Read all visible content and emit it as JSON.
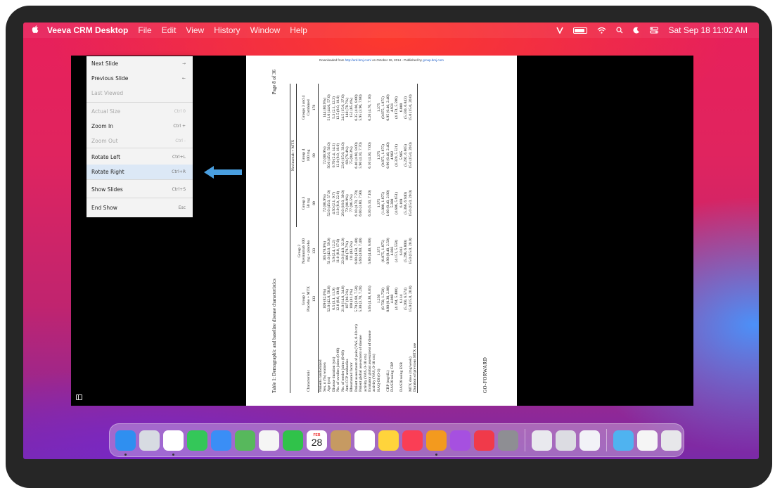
{
  "menubar": {
    "app_name": "Veeva CRM Desktop",
    "menus": [
      "File",
      "Edit",
      "View",
      "History",
      "Window",
      "Help"
    ],
    "clock": "Sat Sep 18  11:02 AM"
  },
  "slide": {
    "download_prefix": "Downloaded from ",
    "download_link": "http://ard.bmj.com/",
    "download_mid": " on October 26, 2014 - Published by ",
    "download_link2": "group.bmj.com",
    "table_title": "Table 1: Demographic and baseline disease characteristics",
    "page_label": "Page 8 of 36",
    "footer": "GO-FORWARD",
    "header_group_span": "Navinumab + MTX",
    "columns": [
      "Characteristic",
      "Group 1\nPlacebo + MTX",
      "Group 2\nNavinumab 100\nmg + placebo",
      "Group 3\n50 mg",
      "Group 4\n100 mg",
      "Groups 3 and 4\nCombined"
    ],
    "n_row": [
      "",
      "133",
      "133",
      "89",
      "89",
      "178"
    ],
    "rows": [
      [
        "Patients randomized",
        "",
        "",
        "",
        "",
        ""
      ],
      [
        "Sex, n (%) women",
        "109 (82.0%)",
        "105 (78.9%)",
        "72 (80.9%)",
        "72 (80.9%)",
        "144 (80.9%)"
      ],
      [
        "Age (yrs)",
        "52.0 (42.0, 58.0)",
        "51.0 (42.0, 59.0)",
        "52.0 (45.0, 57.0)",
        "50.0 (45.0, 56.0)",
        "51.0 (44.0, 57.0)"
      ],
      [
        "Disease duration (yrs)",
        "6.5 (3.1, 11.9)",
        "5.9 (2.4, 12.2)",
        "4.50 (2.1, 9.7)",
        "6.70 (2.4, 14.3)",
        "5.3 (2.1, 12.3)"
      ],
      [
        "No. of swollen joints (0-66)",
        "12.0 (8.0, 19.0)",
        "11.0 (8.0, 17.0)",
        "13.0 (8.0, 22.0)",
        "12.0 (8.0, 18.0)",
        "12.5 (8.0, 18.0)"
      ],
      [
        "No. of tender joints (0-68)",
        "21.0 (14.0, 34.0)",
        "22.0 (14.0, 32.0)",
        "26.0 (16.0, 39.0)",
        "23.0 (15.0, 33.0)",
        "24.5 (15.0, 37.0)"
      ],
      [
        "Anti-CCP antibodies",
        "107 (80.5%)",
        "106 (79.7%)",
        "72 (80.9%)",
        "68 (76.4%)",
        "140 (78.7%)"
      ],
      [
        "Rheumatoid factor",
        "108 (81.2%)",
        "111 (83.5%)",
        "77 (86.5%)",
        "75 (84.3%)",
        "152 (85.4%)"
      ],
      [
        "Patient assessment of pain (VAS, 0-10 cm)",
        "5.70 (3.60, 7.50)",
        "6.00 (4.50, 7.40)",
        "6.10 (4.70, 7.70)",
        "6.40 (4.60, 8.00)",
        "6.35 (4.60, 8.00)"
      ],
      [
        "Patient global assessment of disease activity (VAS, 0-10 cm)",
        "5.30 (3.70, 7.20)",
        "5.60 (3.60, 7.40)",
        "6.00 (3.80, 7.90)",
        "5.90 (4.10, 7.70)",
        "5.95 (3.90, 7.80)"
      ],
      [
        "Evaluator global assessment of disease activity (VAS, 0-10 cm)",
        "5.65 (4.30, 6.85)",
        "5.80 (4.40, 6.80)",
        "6.30 (5.10, 7.10)",
        "6.10 (4.30, 7.00)",
        "6.20 (4.70, 7.10)"
      ],
      [
        "HAQ-DI (0-3)",
        "1.250\n(0.750, 1.750)",
        "1.375\n(0.875, 1.875)",
        "1.375\n(1.000, 1.875)",
        "1.375\n(0.875, 1.875)",
        "1.375\n(0.875, 1.875)"
      ],
      [
        "CRP (mg/dL)",
        "0.80 (0.30, 2.00)",
        "0.90 (0.40, 2.50)",
        "1.00 (0.40, 2.80)",
        "0.90 (0.40, 2.40)",
        "0.95 (0.40, 2.40)"
      ],
      [
        "DAS28 using CRP",
        "4.860\n(4.194, 5.480)",
        "4.803\n(4.151, 5.558)",
        "5.300\n(4.606, 5.651)",
        "4.902\n(4.320, 5.521)",
        "4.931\n(4.174, 5.598)"
      ],
      [
        "DAS28 using ESR",
        "6.114\n(5.260, 6.574)",
        "6.013\n(5.298, 6.800)",
        "6.169\n(5.366, 6.940)",
        "5.905\n(5.292, 6.805)",
        "6.000\n(5.330, 6.843)"
      ],
      [
        "MTX dose (mg/week)",
        "15.0 (15.0, 20.0)",
        "15.0 (15.0, 20.0)",
        "15.0 (15.0, 20.0)",
        "15.0 (15.0, 20.0)",
        "15.0 (15.0, 20.0)"
      ],
      [
        "Duration of previous MTX use",
        "",
        "",
        "",
        "",
        ""
      ]
    ]
  },
  "context_menu": {
    "items": [
      {
        "label": "Next Slide",
        "shortcut": "→",
        "disabled": false
      },
      {
        "label": "Previous Slide",
        "shortcut": "←",
        "disabled": false
      },
      {
        "label": "Last Viewed",
        "shortcut": "",
        "disabled": true
      },
      {
        "label": "Actual Size",
        "shortcut": "Ctrl 0",
        "disabled": true
      },
      {
        "label": "Zoom In",
        "shortcut": "Ctrl +",
        "disabled": false
      },
      {
        "label": "Zoom Out",
        "shortcut": "Ctrl -",
        "disabled": true
      },
      {
        "label": "Rotate Left",
        "shortcut": "Ctrl+L",
        "disabled": false
      },
      {
        "label": "Rotate Right",
        "shortcut": "Ctrl+R",
        "disabled": false
      },
      {
        "label": "Show Slides",
        "shortcut": "Ctrl+S",
        "disabled": false
      },
      {
        "label": "End Show",
        "shortcut": "Esc",
        "disabled": false
      }
    ]
  },
  "dock": {
    "calendar": {
      "month": "FEB",
      "day": "28"
    },
    "apps": [
      {
        "name": "finder-icon",
        "color": "#2f8ff0"
      },
      {
        "name": "launchpad-icon",
        "color": "#d7dbe2"
      },
      {
        "name": "chrome-icon",
        "color": "#ffffff"
      },
      {
        "name": "messages-icon",
        "color": "#34c759"
      },
      {
        "name": "mail-icon",
        "color": "#3a8ef6"
      },
      {
        "name": "maps-icon",
        "color": "#57b85c"
      },
      {
        "name": "photos-icon",
        "color": "#f5f5f5"
      },
      {
        "name": "facetime-icon",
        "color": "#30c24a"
      },
      {
        "name": "calendar-icon",
        "color": "#ffffff"
      },
      {
        "name": "contacts-icon",
        "color": "#c69a62"
      },
      {
        "name": "reminders-icon",
        "color": "#ffffff"
      },
      {
        "name": "notes-icon",
        "color": "#ffd43b"
      },
      {
        "name": "music-icon",
        "color": "#fa3e55"
      },
      {
        "name": "veeva-icon",
        "color": "#f39a1e"
      },
      {
        "name": "podcasts-icon",
        "color": "#a650e0"
      },
      {
        "name": "news-icon",
        "color": "#f03a4a"
      },
      {
        "name": "system-preferences-icon",
        "color": "#8e8e93"
      },
      {
        "name": "script-editor-icon",
        "color": "#e9e9ee"
      },
      {
        "name": "preview-icon",
        "color": "#dcdce2"
      },
      {
        "name": "app-icon",
        "color": "#f2f2f7"
      },
      {
        "name": "folder-icon",
        "color": "#4fb3f0"
      },
      {
        "name": "document-icon",
        "color": "#f5f5f5"
      },
      {
        "name": "trash-icon",
        "color": "#e7e7ea"
      }
    ]
  }
}
